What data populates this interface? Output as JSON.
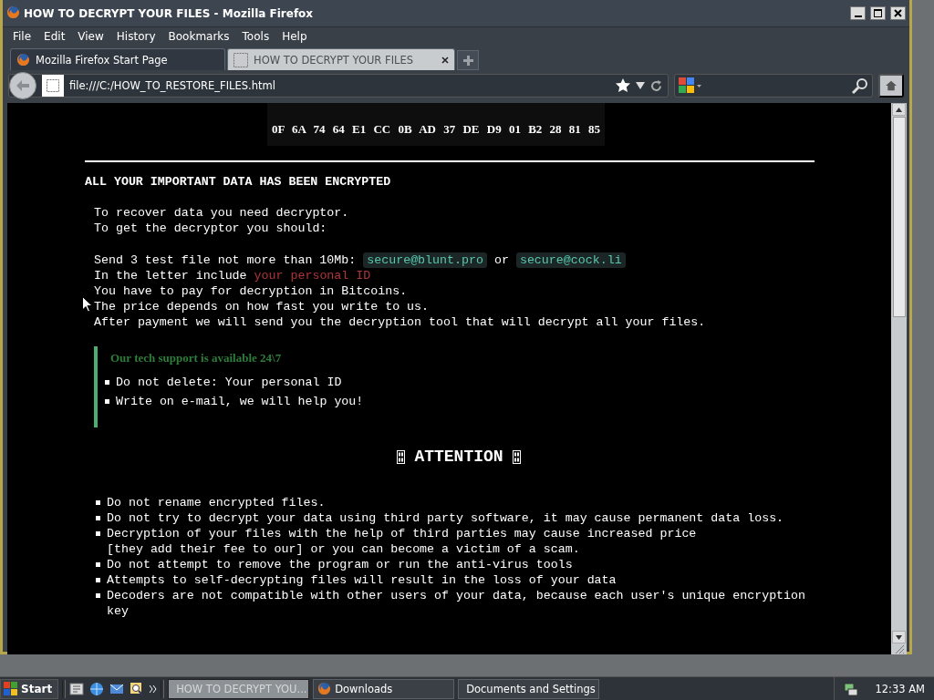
{
  "window": {
    "title": "HOW TO DECRYPT YOUR FILES - Mozilla Firefox"
  },
  "menu": [
    "File",
    "Edit",
    "View",
    "History",
    "Bookmarks",
    "Tools",
    "Help"
  ],
  "tabs": [
    {
      "label": "Mozilla Firefox Start Page",
      "selected": false
    },
    {
      "label": "HOW TO DECRYPT YOUR FILES",
      "selected": true
    }
  ],
  "address": {
    "value": "file:///C:/HOW_TO_RESTORE_FILES.html"
  },
  "page": {
    "key_row": "0F 6A 74 64 E1 CC 0B AD 37 DE D9 01 B2 28 81 85",
    "heading": "ALL YOUR IMPORTANT DATA HAS BEEN ENCRYPTED",
    "paragraphs": [
      [
        [
          {
            "kind": "text",
            "text": "To recover data you need decryptor."
          }
        ],
        [
          {
            "kind": "text",
            "text": "To get the decryptor you should:"
          }
        ]
      ],
      [
        [
          {
            "kind": "text",
            "text": "Send 3 test file not more than 10Mb:"
          },
          {
            "kind": "email",
            "text": "secure@blunt.pro"
          },
          {
            "kind": "text",
            "text": "or"
          },
          {
            "kind": "email",
            "text": "secure@cock.li"
          }
        ],
        [
          {
            "kind": "text",
            "text": "In the letter include"
          },
          {
            "kind": "alert",
            "text": "your personal ID"
          }
        ],
        [
          {
            "kind": "text",
            "text": "You have to pay for decryption in Bitcoins."
          }
        ],
        [
          {
            "kind": "text",
            "text": "The price depends on how fast you write to us."
          }
        ],
        [
          {
            "kind": "text",
            "text": "After payment we will send you the decryption tool that will decrypt all your files."
          }
        ]
      ]
    ],
    "support": {
      "title": "Our tech support is available 24\\7",
      "items": [
        "Do not delete: Your personal ID",
        "Write on e-mail, we will help you!"
      ]
    },
    "attention": {
      "title": "ATTENTION",
      "items": [
        "Do not rename encrypted files.",
        "Do not try to decrypt your data using third party software, it may cause permanent data loss.",
        "Decryption of your files with the help of third parties may cause increased price\n[they add their fee to our] or you can become a victim of a scam.",
        "Do not attempt to remove the program or run the anti-virus tools",
        "Attempts to self-decrypting files will result in the loss of your data",
        "Decoders are not compatible with other users of your data, because each user's unique encryption key"
      ]
    }
  },
  "taskbar": {
    "start": "Start",
    "tasks": [
      {
        "label": "HOW TO DECRYPT YOU...",
        "kind": "browser",
        "selected": true
      },
      {
        "label": "Downloads",
        "kind": "browser",
        "selected": false
      },
      {
        "label": "Documents and Settings",
        "kind": "folder",
        "selected": false
      }
    ],
    "clock": "12:33 AM"
  }
}
